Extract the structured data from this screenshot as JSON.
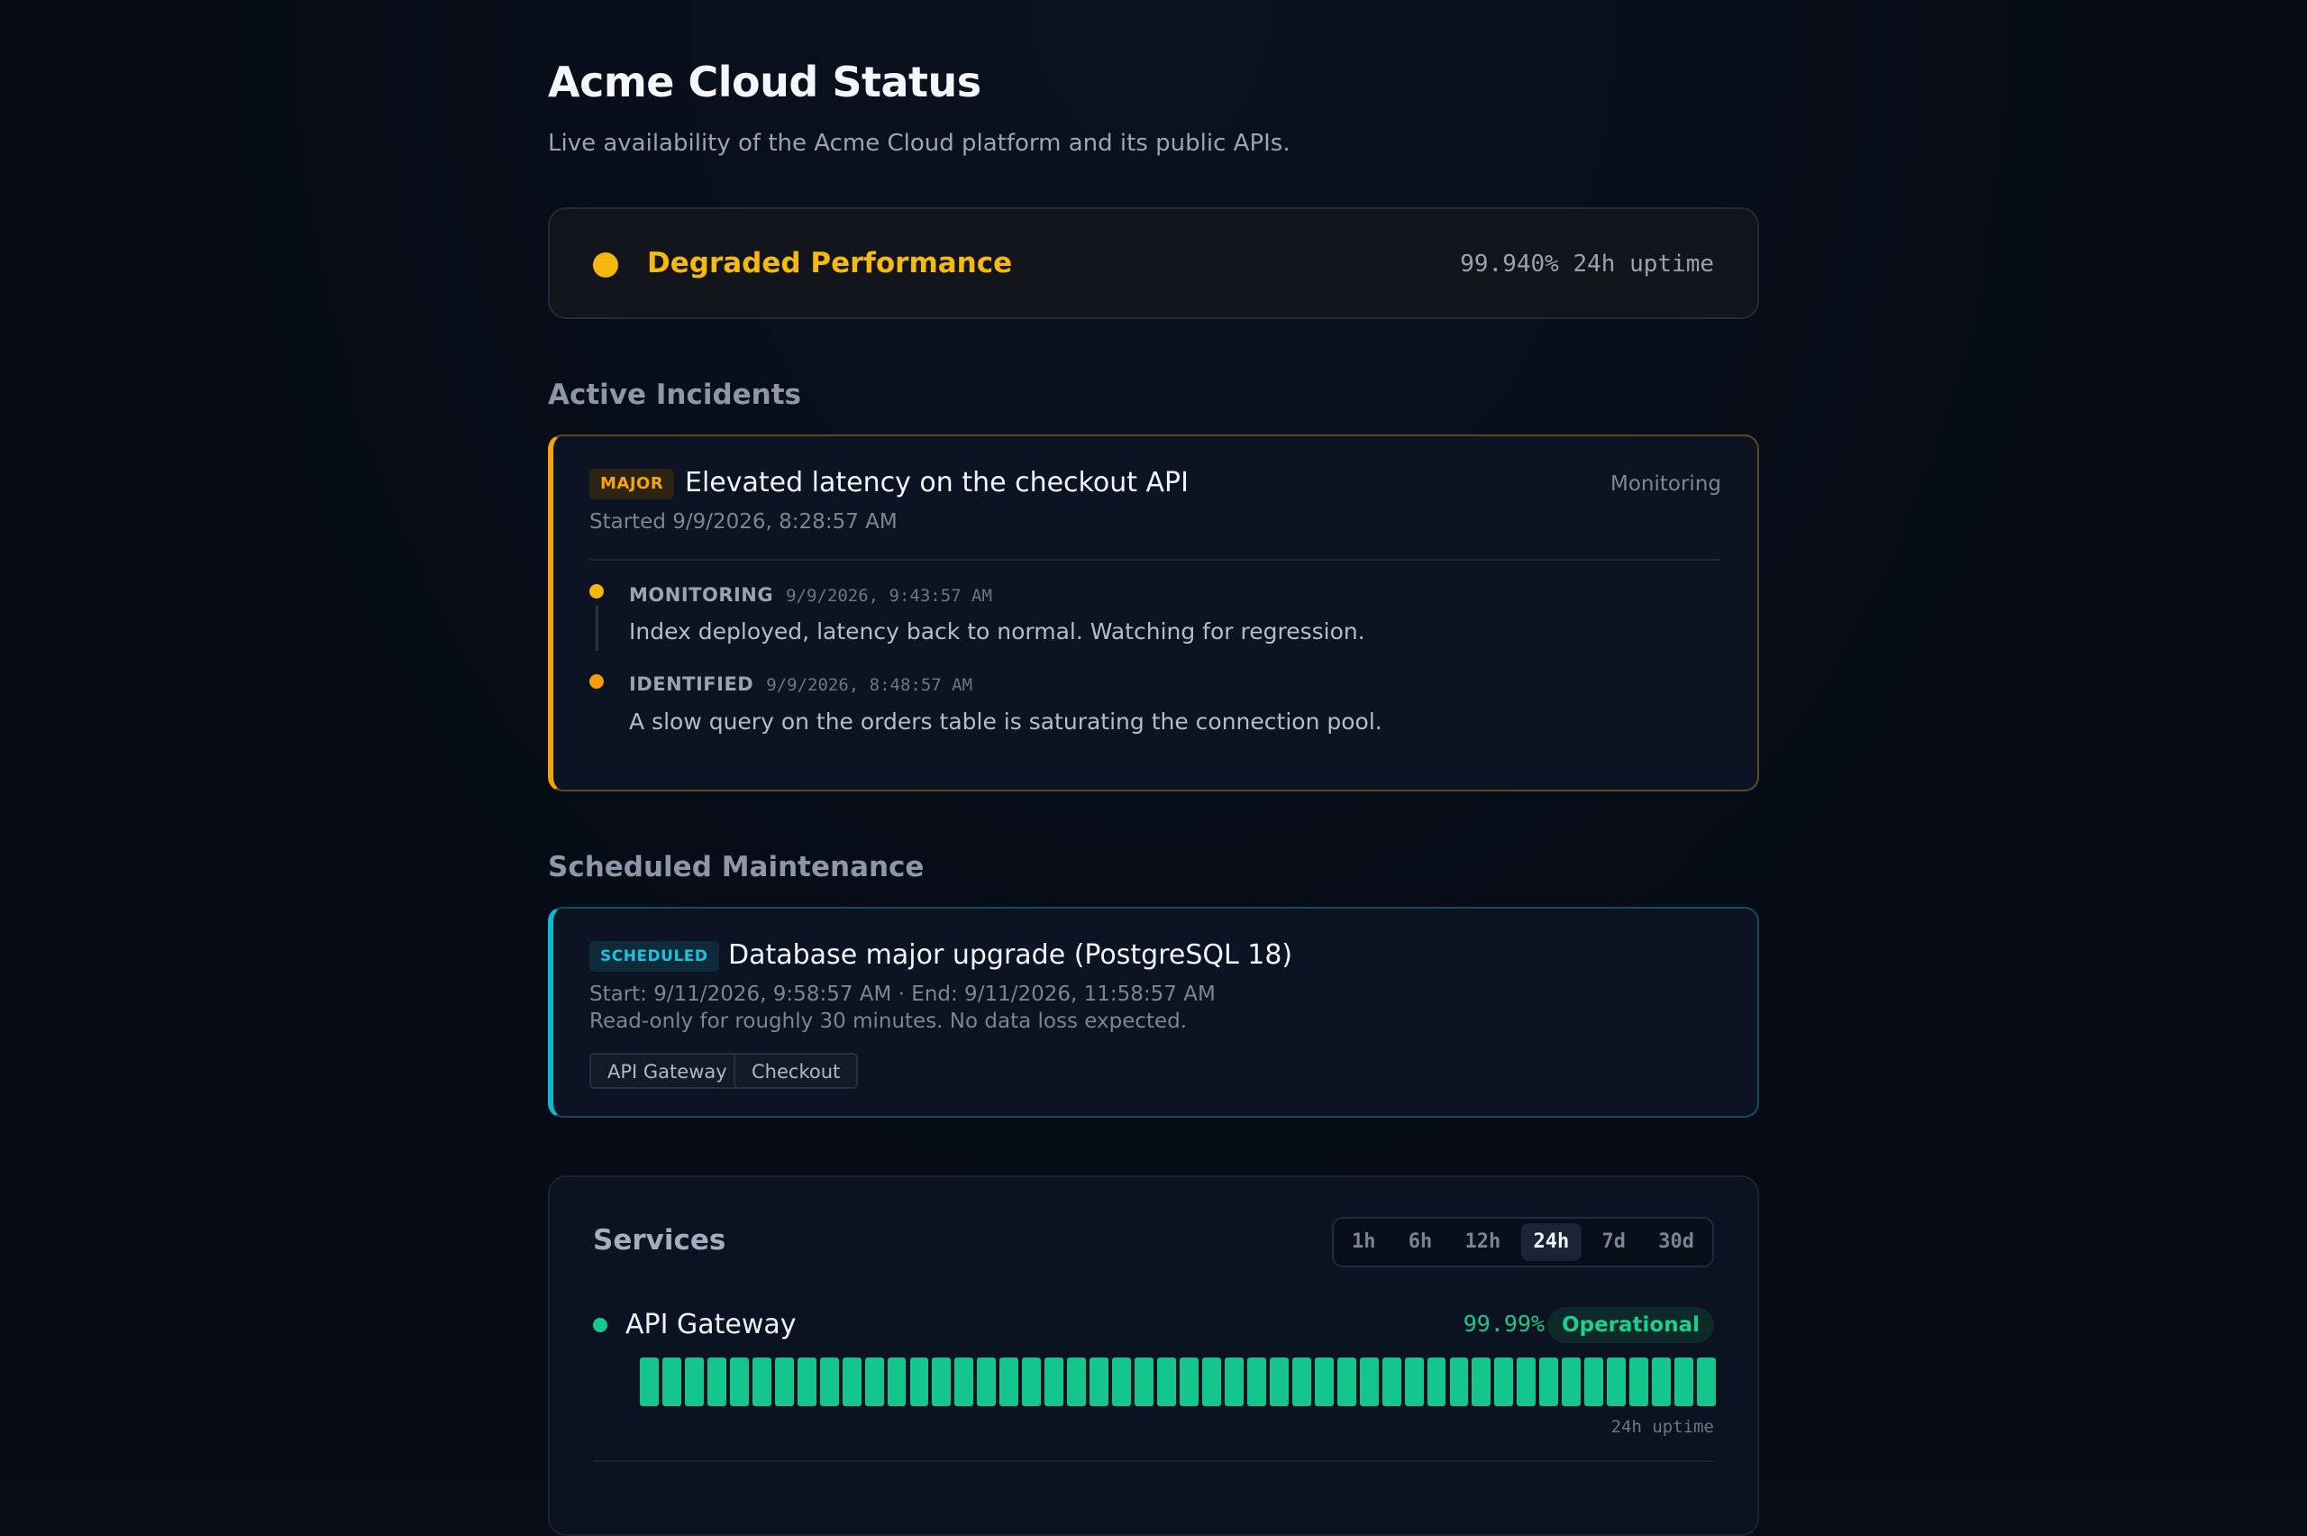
{
  "header": {
    "title": "Acme Cloud Status",
    "subtitle": "Live availability of the Acme Cloud platform and its public APIs."
  },
  "overall": {
    "status": "Degraded Performance",
    "uptime": "99.940% 24h uptime",
    "color": "#f5b70b"
  },
  "incidents": {
    "section_title": "Active Incidents",
    "items": [
      {
        "severity": "MAJOR",
        "title": "Elevated latency on the checkout API",
        "status": "Monitoring",
        "started": "Started 9/9/2026, 8:28:57 AM",
        "updates": [
          {
            "label": "MONITORING",
            "time": "9/9/2026, 9:43:57 AM",
            "text": "Index deployed, latency back to normal. Watching for regression.",
            "color": "#f5b70b"
          },
          {
            "label": "IDENTIFIED",
            "time": "9/9/2026, 8:48:57 AM",
            "text": "A slow query on the orders table is saturating the connection pool.",
            "color": "#f59e0b"
          }
        ]
      }
    ]
  },
  "maintenance": {
    "section_title": "Scheduled Maintenance",
    "items": [
      {
        "badge": "SCHEDULED",
        "title": "Database major upgrade (PostgreSQL 18)",
        "window": "Start: 9/11/2026, 9:58:57 AM · End: 9/11/2026, 11:58:57 AM",
        "description": "Read-only for roughly 30 minutes. No data loss expected.",
        "components": [
          "API Gateway",
          "Checkout"
        ]
      }
    ]
  },
  "services": {
    "title": "Services",
    "ranges": [
      "1h",
      "6h",
      "12h",
      "24h",
      "7d",
      "30d"
    ],
    "selected_range": "24h",
    "items": [
      {
        "name": "API Gateway",
        "uptime": "99.99%",
        "status": "Operational",
        "caption": "24h uptime",
        "color": "#14c68c",
        "bar_count": 48
      }
    ]
  }
}
